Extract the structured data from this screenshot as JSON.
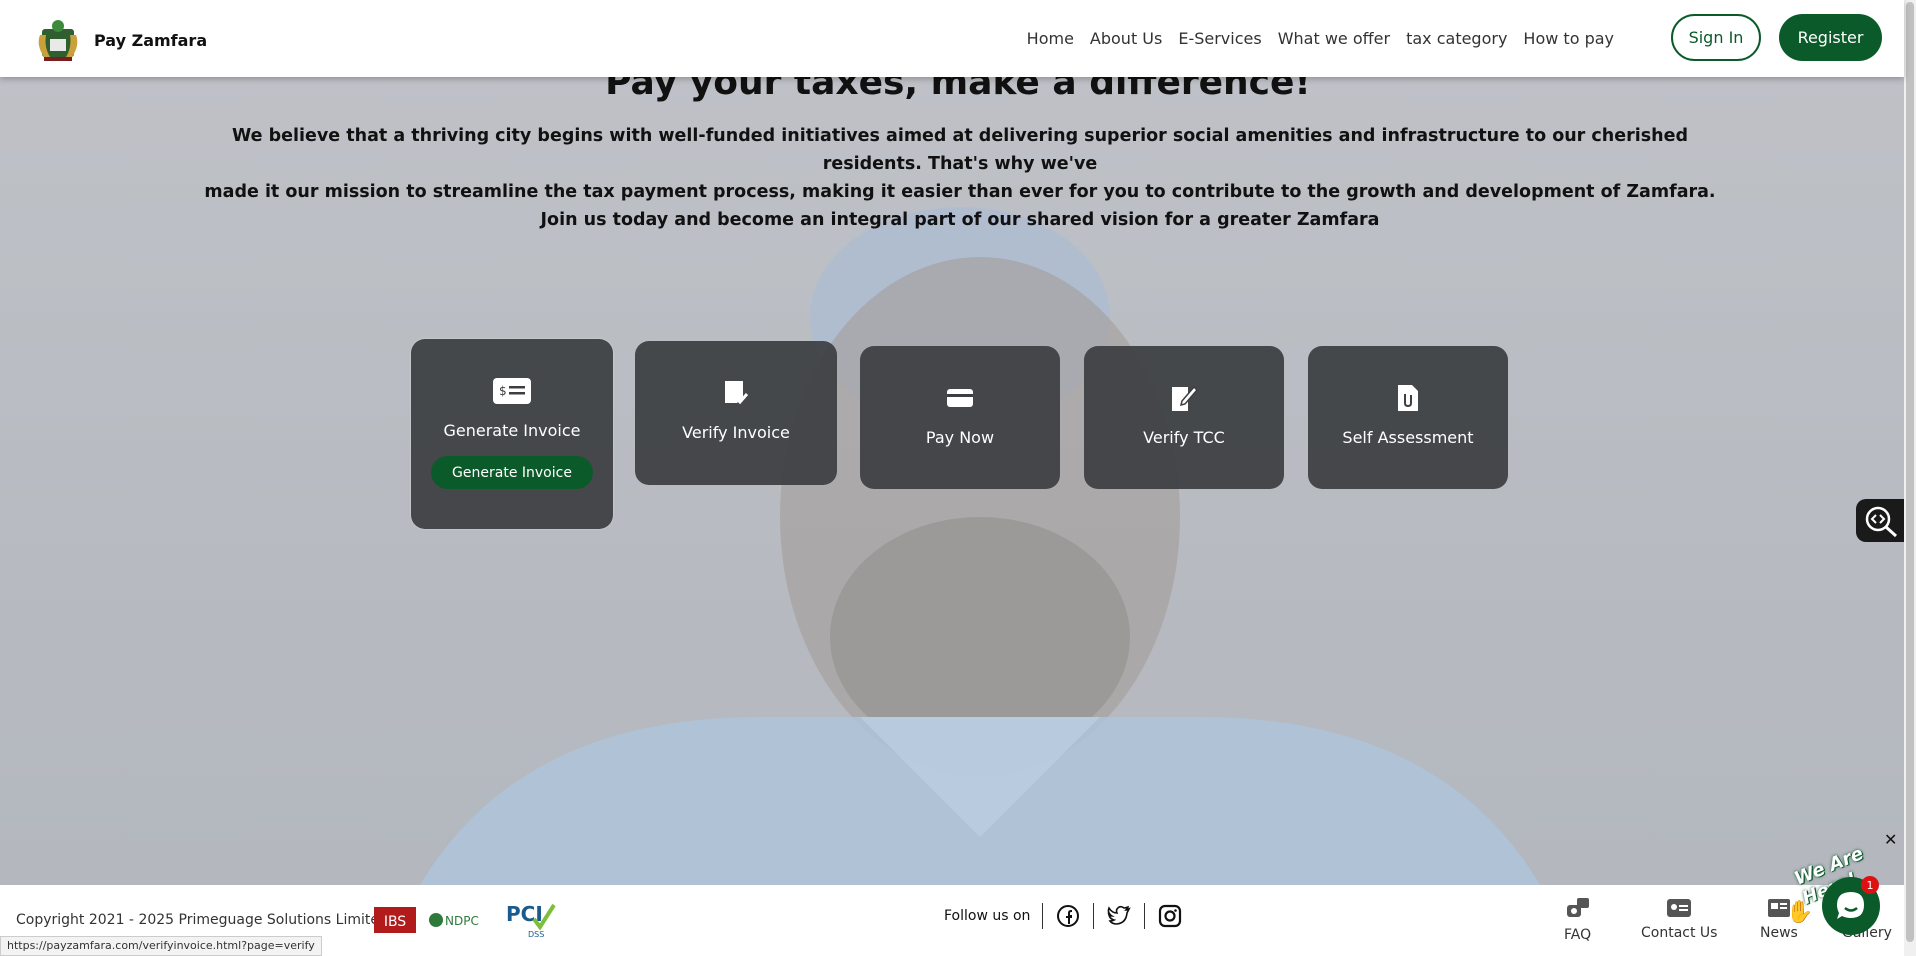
{
  "header": {
    "brand_name": "Pay Zamfara",
    "nav": [
      "Home",
      "About Us",
      "E-Services",
      "What we offer",
      "tax category",
      "How to pay"
    ],
    "signin_label": "Sign In",
    "register_label": "Register"
  },
  "hero": {
    "title": "Pay your taxes, make a difference!",
    "lines": [
      "We believe that a thriving city begins with well-funded initiatives aimed at delivering superior social amenities and infrastructure to our cherished residents. That's why we've",
      "made it our mission to streamline the tax payment process, making it easier than ever for you to contribute to the growth and development of Zamfara.",
      "Join us today and become an integral part of our shared vision for a greater Zamfara"
    ]
  },
  "cards": [
    {
      "label": "Generate Invoice",
      "icon": "invoice-icon",
      "button": "Generate Invoice"
    },
    {
      "label": "Verify Invoice",
      "icon": "verify-doc-icon"
    },
    {
      "label": "Pay Now",
      "icon": "card-icon"
    },
    {
      "label": "Verify TCC",
      "icon": "edit-doc-icon"
    },
    {
      "label": "Self Assessment",
      "icon": "attach-doc-icon"
    }
  ],
  "footer": {
    "copyright": "Copyright 2021 - 2025 Primeguage Solutions Limited",
    "partners": [
      "IBS",
      "NDPC",
      "PCI DSS"
    ],
    "follow_label": "Follow us on",
    "quick_links": [
      "FAQ",
      "Contact Us",
      "News",
      "Gallery"
    ]
  },
  "status_url": "https://payzamfara.com/verifyinvoice.html?page=verify",
  "chat": {
    "badge_text": "We Are Here!",
    "count": "1"
  },
  "colors": {
    "brand_green": "#0b5a2a",
    "card_bg": "#3c3e42"
  }
}
